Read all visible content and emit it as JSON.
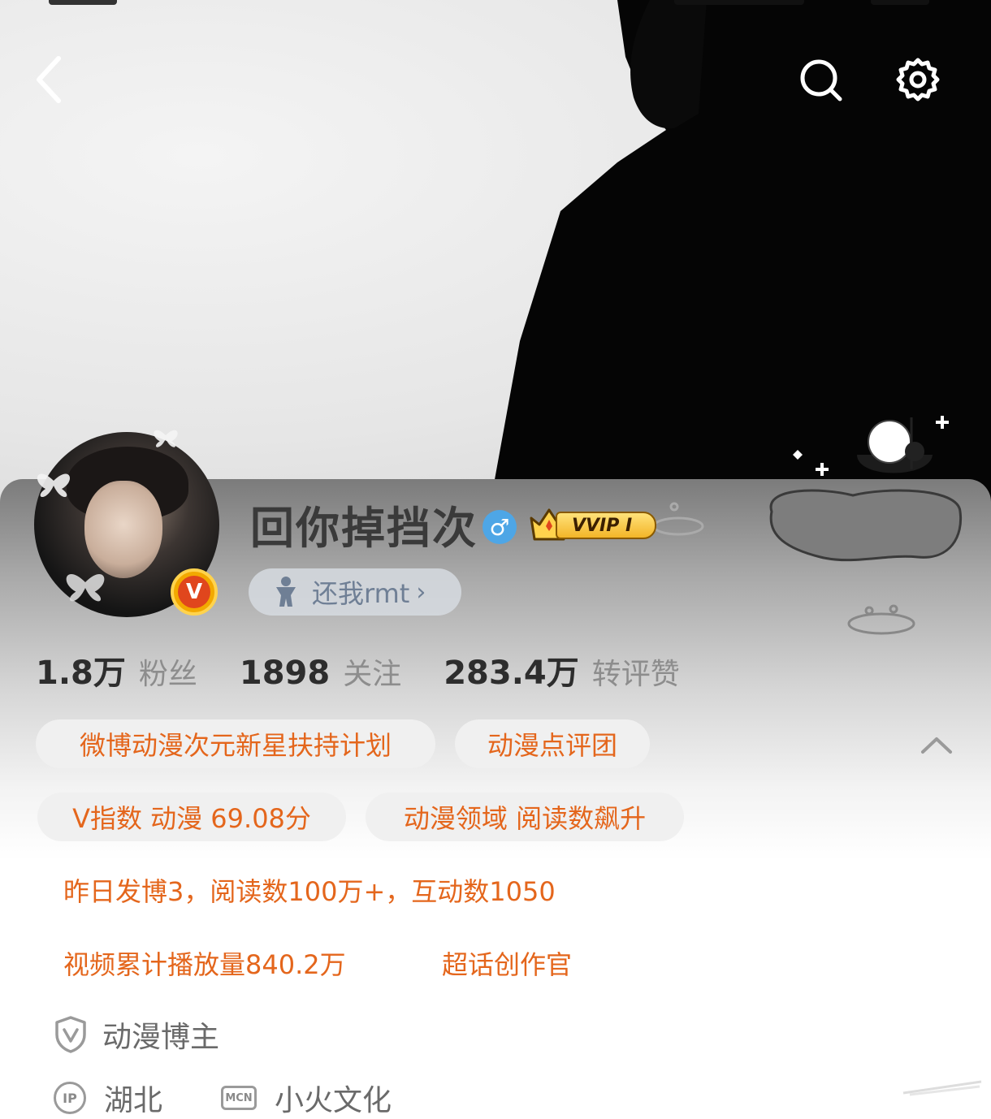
{
  "header": {
    "back_icon": "chevron-left-icon",
    "search_icon": "search-icon",
    "settings_icon": "gear-icon"
  },
  "profile": {
    "name": "回你掉挡次",
    "gender_symbol": "♂",
    "verified_badge": "V",
    "vip_label": "VVIP I",
    "fan_club": {
      "label": "还我rmt",
      "chevron": "›"
    }
  },
  "stats": [
    {
      "value": "1.8万",
      "label": "粉丝"
    },
    {
      "value": "1898",
      "label": "关注"
    },
    {
      "value": "283.4万",
      "label": "转评赞"
    }
  ],
  "tags": {
    "row1": [
      "微博动漫次元新星扶持计划",
      "动漫点评团"
    ],
    "row2": [
      "V指数 动漫 69.08分",
      "动漫领域 阅读数飙升"
    ],
    "row3": "昨日发博3，阅读数100万+，互动数1050",
    "row4": [
      "视频累计播放量840.2万",
      "超话创作官"
    ]
  },
  "info": {
    "role": "动漫博主",
    "ip_badge": "IP",
    "location": "湖北",
    "mcn_badge": "MCN",
    "mcn": "小火文化"
  },
  "colors": {
    "accent": "#e4661c",
    "tag_bg": "#f0f0f0",
    "gender_blue": "#4ea6e6",
    "verified_orange": "#f2a900"
  }
}
